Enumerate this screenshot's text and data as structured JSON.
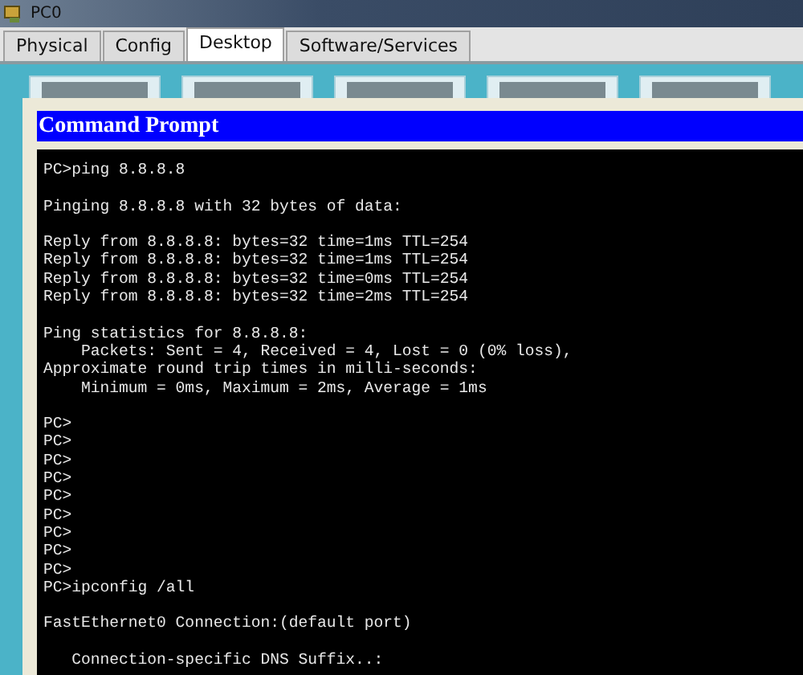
{
  "window": {
    "title": "PC0"
  },
  "tabs": [
    {
      "label": "Physical",
      "selected": false
    },
    {
      "label": "Config",
      "selected": false
    },
    {
      "label": "Desktop",
      "selected": true
    },
    {
      "label": "Software/Services",
      "selected": false
    }
  ],
  "command_prompt": {
    "title": "Command Prompt",
    "blocks": [
      [
        "PC>ping 8.8.8.8"
      ],
      [
        "Pinging 8.8.8.8 with 32 bytes of data:"
      ],
      [
        "Reply from 8.8.8.8: bytes=32 time=1ms TTL=254",
        "Reply from 8.8.8.8: bytes=32 time=1ms TTL=254",
        "Reply from 8.8.8.8: bytes=32 time=0ms TTL=254",
        "Reply from 8.8.8.8: bytes=32 time=2ms TTL=254"
      ],
      [
        "Ping statistics for 8.8.8.8:",
        "    Packets: Sent = 4, Received = 4, Lost = 0 (0% loss),",
        "Approximate round trip times in milli-seconds:",
        "    Minimum = 0ms, Maximum = 2ms, Average = 1ms"
      ],
      [
        "PC>",
        "PC>",
        "PC>",
        "PC>",
        "PC>",
        "PC>",
        "PC>",
        "PC>",
        "PC>",
        "PC>ipconfig /all"
      ],
      [
        "FastEthernet0 Connection:(default port)"
      ],
      [
        "   Connection-specific DNS Suffix..:"
      ]
    ]
  }
}
